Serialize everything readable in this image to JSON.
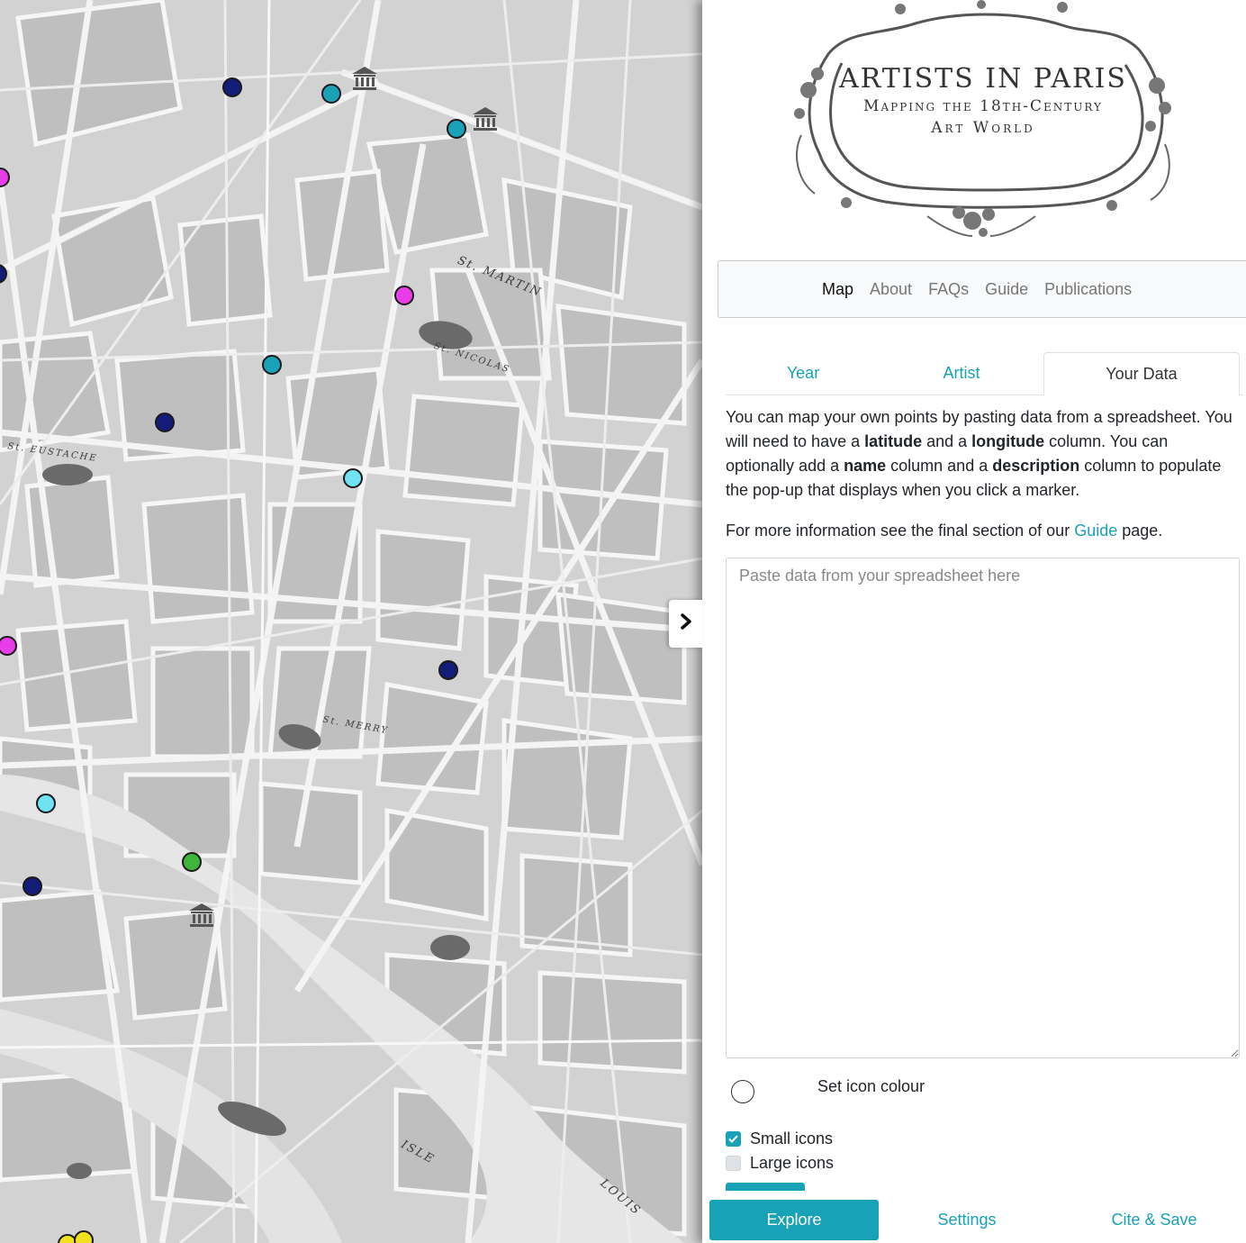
{
  "logo": {
    "title": "ARTISTS IN PARIS",
    "subtitle_line1": "Mapping the 18th-Century",
    "subtitle_line2": "Art World"
  },
  "nav": {
    "items": [
      {
        "label": "Map",
        "active": true
      },
      {
        "label": "About",
        "active": false
      },
      {
        "label": "FAQs",
        "active": false
      },
      {
        "label": "Guide",
        "active": false
      },
      {
        "label": "Publications",
        "active": false
      }
    ]
  },
  "tabs": [
    {
      "label": "Year",
      "active": false
    },
    {
      "label": "Artist",
      "active": false
    },
    {
      "label": "Your Data",
      "active": true
    }
  ],
  "your_data": {
    "intro_1": "You can map your own points by pasting data from a spreadsheet. You will need to have a ",
    "kw_latitude": "latitude",
    "intro_2": " and a ",
    "kw_longitude": "longitude",
    "intro_3": " column. You can optionally add a ",
    "kw_name": "name",
    "intro_4": " column and a ",
    "kw_description": "description",
    "intro_5": " column to populate the pop-up that displays when you click a marker.",
    "more_1": "For more information see the final section of our ",
    "more_link": "Guide",
    "more_2": " page.",
    "textarea_placeholder": "Paste data from your spreadsheet here",
    "textarea_value": "",
    "set_colour_label": "Set icon colour",
    "small_icons_label": "Small icons",
    "small_icons_checked": true,
    "large_icons_label": "Large icons",
    "large_icons_checked": false
  },
  "bottom_nav": {
    "explore": "Explore",
    "settings": "Settings",
    "cite_save": "Cite & Save"
  },
  "colors": {
    "accent": "#17a2b8",
    "marker_navy": "#141c7a",
    "marker_teal": "#1aa3b8",
    "marker_magenta": "#e83de8",
    "marker_lightblue": "#6fe3f2",
    "marker_green": "#3fb53a",
    "marker_yellow": "#f2e21d"
  },
  "map": {
    "labels": [
      "St. MARTIN",
      "St. NICOLAS",
      "St. EUSTACHE",
      "St. MERRY",
      "ISLE",
      "LOUIS"
    ],
    "markers": [
      {
        "color": "navy"
      },
      {
        "color": "teal"
      },
      {
        "color": "teal"
      },
      {
        "color": "magenta"
      },
      {
        "color": "navy"
      },
      {
        "color": "magenta"
      },
      {
        "color": "teal"
      },
      {
        "color": "navy"
      },
      {
        "color": "lightblue"
      },
      {
        "color": "magenta"
      },
      {
        "color": "navy"
      },
      {
        "color": "lightblue"
      },
      {
        "color": "green"
      },
      {
        "color": "navy"
      },
      {
        "color": "yellow"
      },
      {
        "color": "yellow"
      }
    ],
    "museum_icons": 3,
    "toggle_icon": "chevron-right-icon"
  }
}
